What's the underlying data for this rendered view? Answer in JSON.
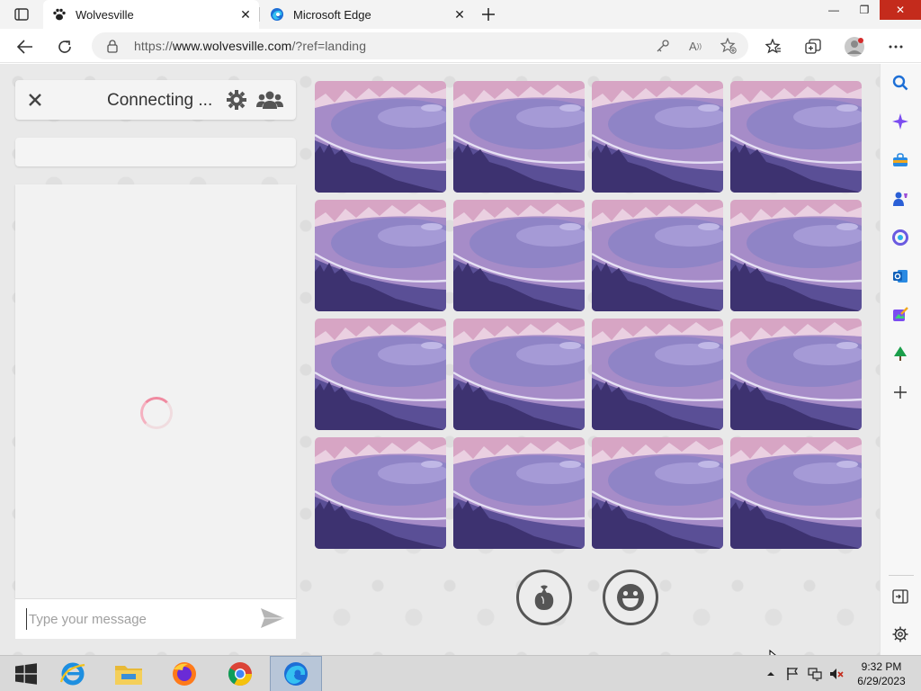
{
  "browser": {
    "tabs": [
      {
        "title": "Wolvesville",
        "active": true,
        "favicon": "paw-icon"
      },
      {
        "title": "Microsoft Edge",
        "active": false,
        "favicon": "edge-icon"
      }
    ],
    "address": {
      "prefix": "https://",
      "host": "www.wolvesville.com",
      "path": "/?ref=landing"
    }
  },
  "chat": {
    "status": "Connecting ...",
    "input_placeholder": "Type your message"
  },
  "game": {
    "player_card_count": 16
  },
  "taskbar": {
    "time": "9:32 PM",
    "date": "6/29/2023"
  },
  "colors": {
    "accent_pink": "#f08aa0",
    "card_sky": "#d7a5c4",
    "card_lake": "#7a72b4",
    "edge_blue": "#1d6fd6"
  }
}
